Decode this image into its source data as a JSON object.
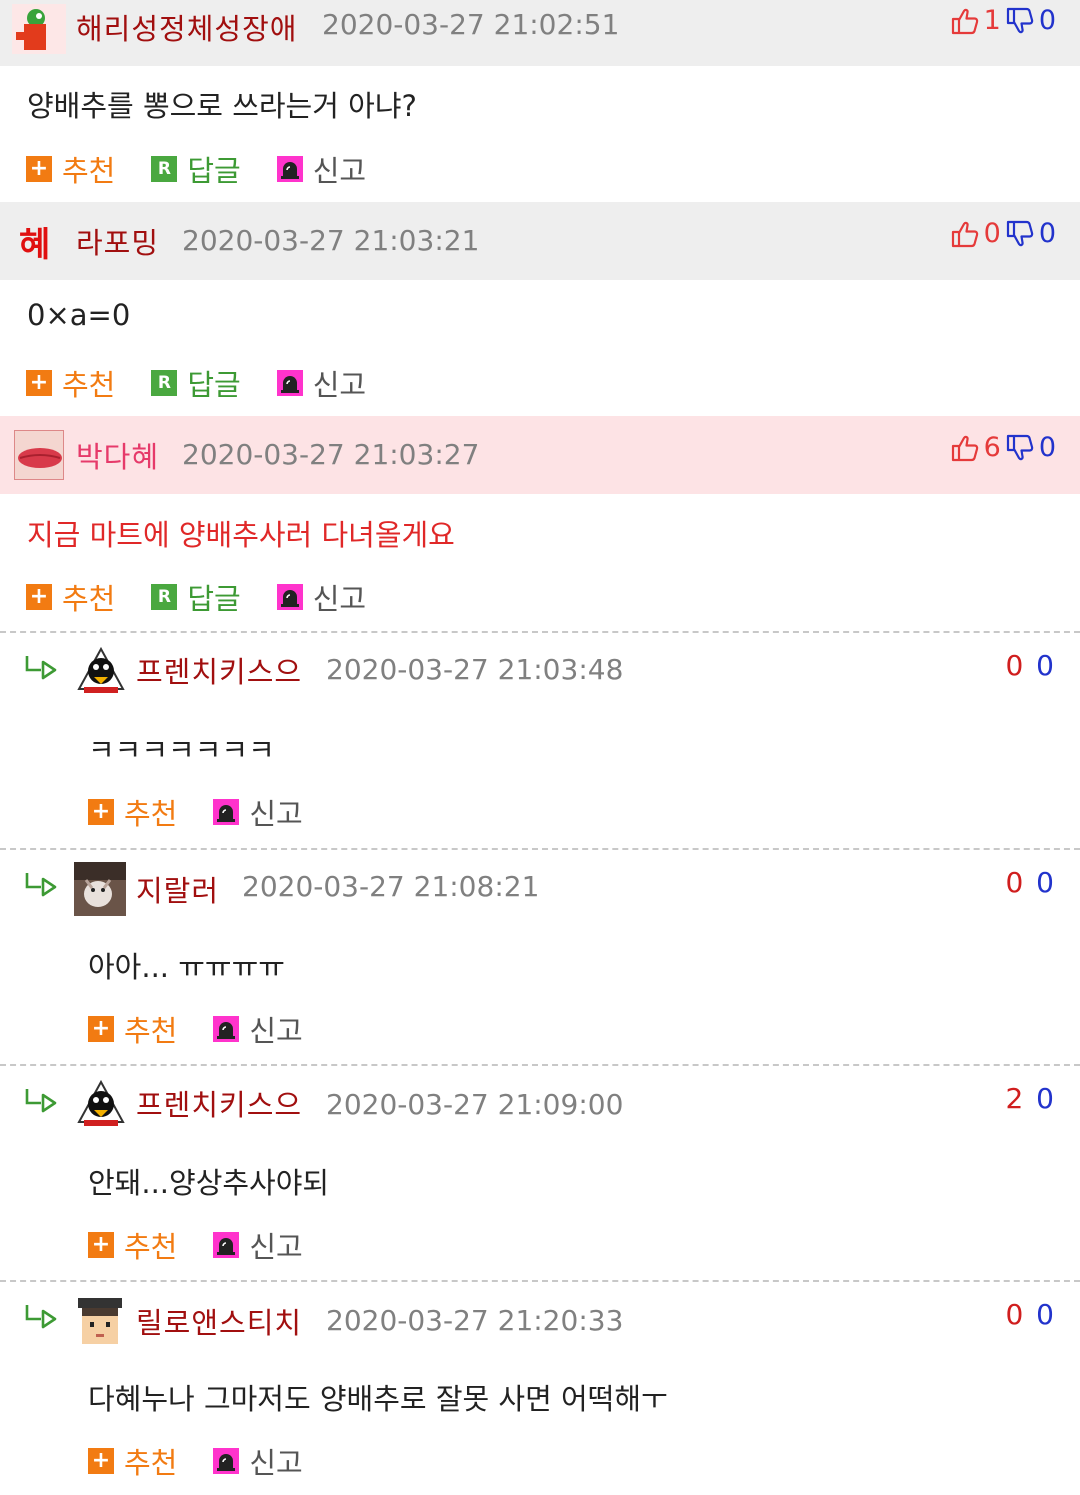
{
  "actions": {
    "recommend": "추천",
    "reply": "답글",
    "report": "신고"
  },
  "comments": [
    {
      "nick": "해리성정체성장애",
      "time": "2020-03-27 21:02:51",
      "up": "1",
      "down": "0",
      "text": "양배추를 뽕으로 쓰라는거 아냐?"
    },
    {
      "nick": "라포밍",
      "time": "2020-03-27 21:03:21",
      "up": "0",
      "down": "0",
      "text": "0×a=0"
    },
    {
      "nick": "박다혜",
      "time": "2020-03-27 21:03:27",
      "up": "6",
      "down": "0",
      "text": "지금 마트에 양배추사러 다녀올게요"
    }
  ],
  "replies": [
    {
      "nick": "프렌치키스으",
      "time": "2020-03-27 21:03:48",
      "up": "0",
      "down": "0",
      "text": "ㅋㅋㅋㅋㅋㅋㅋ"
    },
    {
      "nick": "지랄러",
      "time": "2020-03-27 21:08:21",
      "up": "0",
      "down": "0",
      "text": "아아... ㅠㅠㅠㅠ"
    },
    {
      "nick": "프렌치키스으",
      "time": "2020-03-27 21:09:00",
      "up": "2",
      "down": "0",
      "text": "안돼...양상추사야되"
    },
    {
      "nick": "릴로앤스티치",
      "time": "2020-03-27 21:20:33",
      "up": "0",
      "down": "0",
      "text": "다혜누나 그마저도 양배추로 잘못 사면 어떡해ㅜ"
    }
  ],
  "colors": {
    "nick": "#a10f0f",
    "highlight_nick": "#e63a6a",
    "highlight_bg": "#fde3e5",
    "header_bg": "#eeeeee",
    "recommend": "#f27b12",
    "reply": "#3d9a34",
    "report_icon": "#ff33cc"
  }
}
